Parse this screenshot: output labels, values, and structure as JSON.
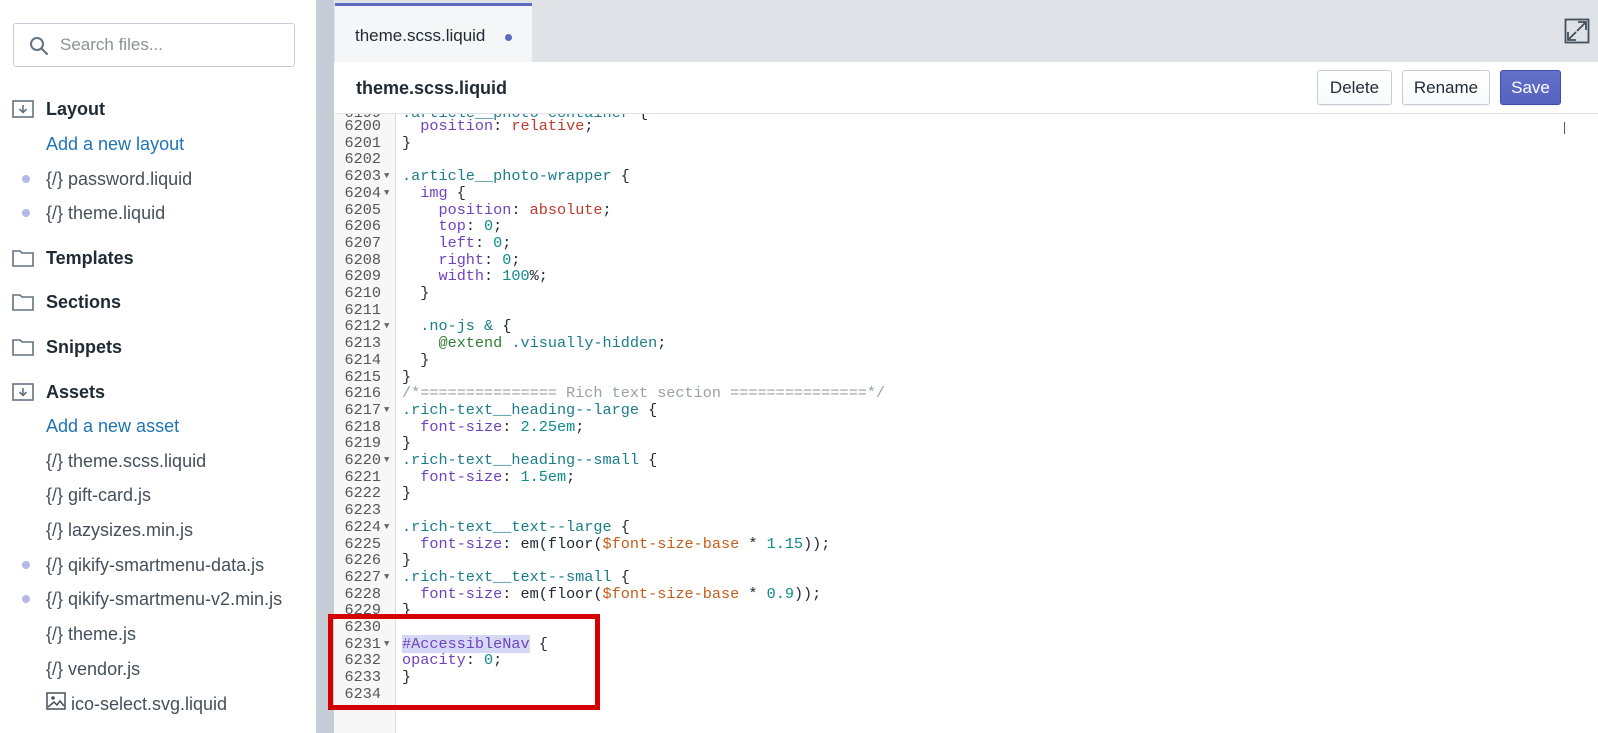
{
  "sidebar": {
    "search": {
      "placeholder": "Search files..."
    },
    "folders": {
      "layout": {
        "label": "Layout",
        "add_label": "Add a new layout",
        "files": [
          {
            "prefix": "{/}",
            "name": "password.liquid"
          },
          {
            "prefix": "{/}",
            "name": "theme.liquid"
          }
        ]
      },
      "templates": {
        "label": "Templates"
      },
      "sections": {
        "label": "Sections"
      },
      "snippets": {
        "label": "Snippets"
      },
      "assets": {
        "label": "Assets",
        "add_label": "Add a new asset",
        "files": [
          {
            "prefix": "{/}",
            "name": "theme.scss.liquid"
          },
          {
            "prefix": "{/}",
            "name": "gift-card.js"
          },
          {
            "prefix": "{/}",
            "name": "lazysizes.min.js"
          },
          {
            "prefix": "{/}",
            "name": "qikify-smartmenu-data.js"
          },
          {
            "prefix": "{/}",
            "name": "qikify-smartmenu-v2.min.js"
          },
          {
            "prefix": "{/}",
            "name": "theme.js"
          },
          {
            "prefix": "{/}",
            "name": "vendor.js"
          },
          {
            "prefix": "",
            "name": "ico-select.svg.liquid"
          }
        ]
      }
    }
  },
  "tab": {
    "title": "theme.scss.liquid"
  },
  "header": {
    "file_title": "theme.scss.liquid",
    "delete_label": "Delete",
    "rename_label": "Rename",
    "save_label": "Save"
  },
  "code": {
    "partial_top": ".article__photo-container {",
    "lines": [
      {
        "n": "6200",
        "text": "  position: relative;"
      },
      {
        "n": "6201",
        "text": "}"
      },
      {
        "n": "6202",
        "text": ""
      },
      {
        "n": "6203",
        "text": ".article__photo-wrapper {"
      },
      {
        "n": "6204",
        "text": "  img {"
      },
      {
        "n": "6205",
        "text": "    position: absolute;"
      },
      {
        "n": "6206",
        "text": "    top: 0;"
      },
      {
        "n": "6207",
        "text": "    left: 0;"
      },
      {
        "n": "6208",
        "text": "    right: 0;"
      },
      {
        "n": "6209",
        "text": "    width: 100%;"
      },
      {
        "n": "6210",
        "text": "  }"
      },
      {
        "n": "6211",
        "text": ""
      },
      {
        "n": "6212",
        "text": "  .no-js & {"
      },
      {
        "n": "6213",
        "text": "    @extend .visually-hidden;"
      },
      {
        "n": "6214",
        "text": "  }"
      },
      {
        "n": "6215",
        "text": "}"
      },
      {
        "n": "6216",
        "text": "/*=============== Rich text section ===============*/"
      },
      {
        "n": "6217",
        "text": ".rich-text__heading--large {"
      },
      {
        "n": "6218",
        "text": "  font-size: 2.25em;"
      },
      {
        "n": "6219",
        "text": "}"
      },
      {
        "n": "6220",
        "text": ".rich-text__heading--small {"
      },
      {
        "n": "6221",
        "text": "  font-size: 1.5em;"
      },
      {
        "n": "6222",
        "text": "}"
      },
      {
        "n": "6223",
        "text": ""
      },
      {
        "n": "6224",
        "text": ".rich-text__text--large {"
      },
      {
        "n": "6225",
        "text": "  font-size: em(floor($font-size-base * 1.15));"
      },
      {
        "n": "6226",
        "text": "}"
      },
      {
        "n": "6227",
        "text": ".rich-text__text--small {"
      },
      {
        "n": "6228",
        "text": "  font-size: em(floor($font-size-base * 0.9));"
      },
      {
        "n": "6229",
        "text": "}"
      },
      {
        "n": "6230",
        "text": ""
      },
      {
        "n": "6231",
        "text": "#AccessibleNav {"
      },
      {
        "n": "6232",
        "text": "opacity: 0;"
      },
      {
        "n": "6233",
        "text": "}"
      },
      {
        "n": "6234",
        "text": ""
      }
    ]
  },
  "colors": {
    "accent": "#5c6ac4",
    "link": "#1f73b7",
    "highlight_box": "#d40000"
  }
}
